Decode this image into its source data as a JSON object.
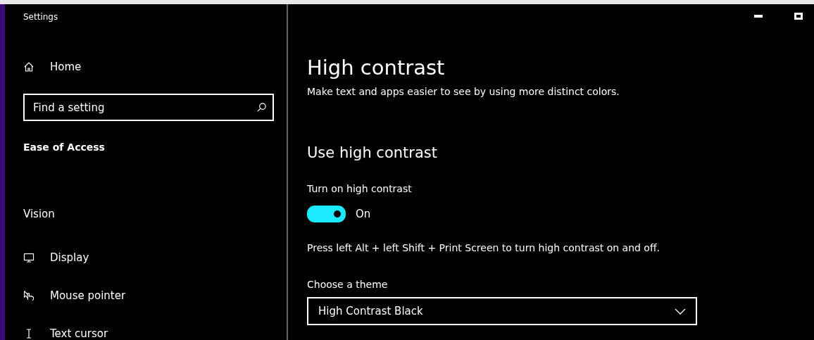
{
  "window": {
    "title": "Settings"
  },
  "sidebar": {
    "home": "Home",
    "search": {
      "placeholder": "Find a setting"
    },
    "category": "Ease of Access",
    "group": "Vision",
    "items": [
      {
        "label": "Display",
        "kind": "monitor"
      },
      {
        "label": "Mouse pointer",
        "kind": "pointer"
      },
      {
        "label": "Text cursor",
        "kind": "cursor"
      }
    ]
  },
  "page": {
    "title": "High contrast",
    "description": "Make text and apps easier to see by using more distinct colors.",
    "section": "Use high contrast",
    "toggle": {
      "label": "Turn on high contrast",
      "on": true,
      "state_text": "On"
    },
    "hint": "Press left Alt + left Shift + Print Screen to turn high contrast on and off.",
    "theme": {
      "label": "Choose a theme",
      "value": "High Contrast Black"
    }
  }
}
